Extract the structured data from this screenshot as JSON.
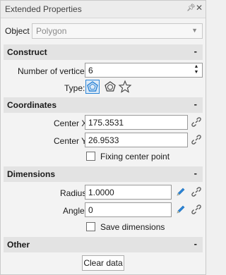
{
  "window": {
    "title": "Extended Properties",
    "pin_icon": "pin-icon",
    "close_icon": "close-icon"
  },
  "object": {
    "label": "Object",
    "value": "Polygon"
  },
  "construct": {
    "title": "Construct",
    "collapse": "-",
    "vertices_label": "Number of vertices",
    "vertices_value": "6",
    "type_label": "Type:",
    "types": [
      "polygon-icon",
      "rounded-polygon-icon",
      "star-icon"
    ],
    "accent": "#2b84d6"
  },
  "coordinates": {
    "title": "Coordinates",
    "collapse": "-",
    "center_x_label": "Center X",
    "center_x_value": "175.3531",
    "center_y_label": "Center Y",
    "center_y_value": "26.9533",
    "fixing_label": "Fixing center point"
  },
  "dimensions": {
    "title": "Dimensions",
    "collapse": "-",
    "radius_label": "Radius",
    "radius_value": "1.0000",
    "angle_label": "Angle",
    "angle_value": "0",
    "save_label": "Save dimensions"
  },
  "other": {
    "title": "Other",
    "collapse": "-",
    "clear_label": "Clear data"
  }
}
